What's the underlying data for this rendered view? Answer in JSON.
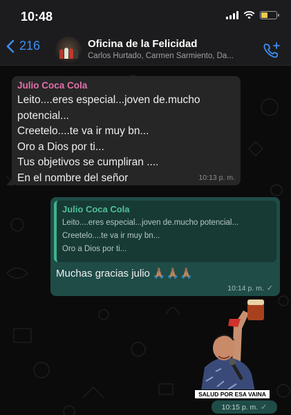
{
  "status_bar": {
    "time": "10:48",
    "battery_color": "#f2c94c"
  },
  "header": {
    "back_count": "216",
    "group_name": "Oficina de la Felicidad",
    "members": "Carlos Hurtado, Carmen Sarmiento, Da...",
    "accent_color": "#3b8ff5"
  },
  "messages": {
    "incoming": {
      "sender": "Julio Coca Cola",
      "lines": [
        "Leito....eres especial...joven de.mucho",
        "potencial...",
        "Creetelo....te va ir muy bn...",
        "Oro a Dios por ti...",
        "Tus objetivos se cumpliran ....",
        "En el nombre del señor"
      ],
      "time": "10:13 p. m."
    },
    "outgoing_reply": {
      "quote_sender": "Julio Coca Cola",
      "quote_lines": [
        "Leito....eres especial...joven de.mucho potencial...",
        "Creetelo....te va ir muy bn...",
        "Oro a Dios por ti..."
      ],
      "text": "Muchas gracias julio",
      "emoji": "🙏🏽🙏🏽🙏🏽",
      "time": "10:14 p. m."
    },
    "sticker": {
      "caption": "SALUD POR ESA VAINA",
      "time": "10:15 p. m."
    }
  }
}
